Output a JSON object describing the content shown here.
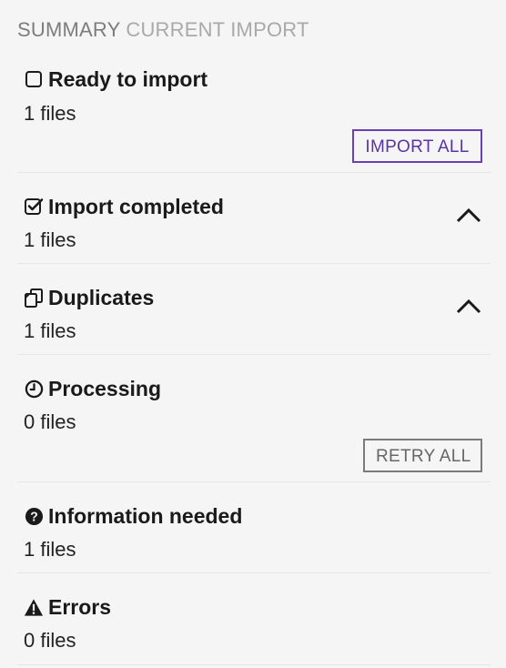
{
  "header": {
    "summary": "SUMMARY",
    "current_import": "CURRENT IMPORT"
  },
  "sections": [
    {
      "title": "Ready to import",
      "count": "1 files",
      "icon": "square-outline-icon",
      "action": "IMPORT ALL"
    },
    {
      "title": "Import completed",
      "count": "1 files",
      "icon": "check-square-icon",
      "toggle": "chevron-up-icon"
    },
    {
      "title": "Duplicates",
      "count": "1 files",
      "icon": "copy-icon",
      "toggle": "chevron-up-icon"
    },
    {
      "title": "Processing",
      "count": "0 files",
      "icon": "clock-icon",
      "action": "RETRY ALL"
    },
    {
      "title": "Information needed",
      "count": "1 files",
      "icon": "question-circle-icon"
    },
    {
      "title": "Errors",
      "count": "0 files",
      "icon": "warning-triangle-icon"
    }
  ],
  "colors": {
    "background": "#f5f5f5",
    "accent_purple": "#6a3fb8",
    "secondary_gray": "#7a7a7a",
    "header_gray": "#7d7d7d",
    "header_light_gray": "#a9a9a9"
  }
}
